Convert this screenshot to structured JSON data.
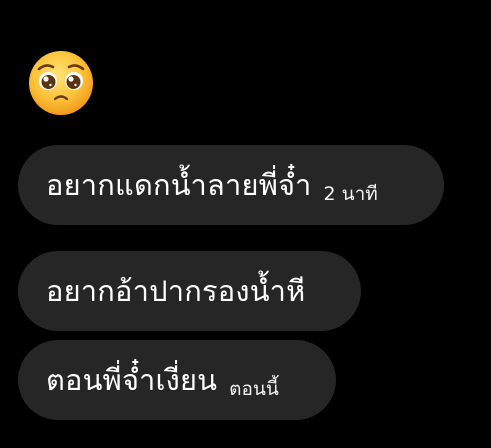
{
  "colors": {
    "background": "#000000",
    "bubble": "#262626",
    "text": "#ffffff"
  },
  "messages": [
    {
      "type": "emoji",
      "icon": "pleading-face-emoji",
      "emoji": "🥺"
    },
    {
      "type": "text",
      "text": "อยากแดกน้ำลายพี่จ๋ำ",
      "time": "2 นาที"
    },
    {
      "type": "text",
      "text": "อยากอ้าปากรองน้ำหี",
      "time": ""
    },
    {
      "type": "text",
      "text": "ตอนพี่จ๋ำเงี่ยน",
      "time": "ตอนนี้"
    }
  ]
}
